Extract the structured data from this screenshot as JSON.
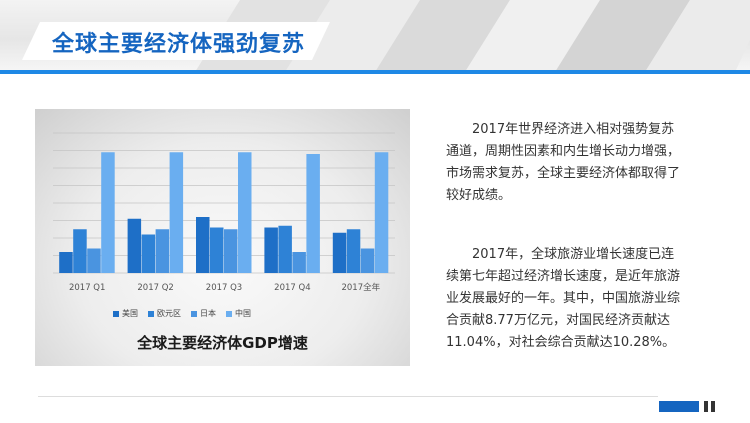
{
  "page": {
    "title": "全球主要经济体强劲复苏"
  },
  "text": {
    "paragraph1_lines": [
      "2017年世界经济进入相对强势复苏",
      "通道，周期性因素和内生增长动力增强，",
      "市场需求复苏，全球主要经济体都取得了",
      "较好成绩。"
    ],
    "paragraph2_lines": [
      "2017年，全球旅游业增长速度已连",
      "续第七年超过经济增长速度，是近年旅游",
      "业发展最好的一年。其中，中国旅游业综",
      "合贡献8.77万亿元，对国民经济贡献达",
      "11.04%，对社会综合贡献达10.28%。"
    ]
  },
  "colors": {
    "accent": "#1e88e5",
    "title": "#1565c0",
    "footer_block": "#1565c0"
  },
  "chart_data": {
    "type": "bar",
    "title": "全球主要经济体GDP增速",
    "categories": [
      "2017 Q1",
      "2017 Q2",
      "2017 Q3",
      "2017 Q4",
      "2017全年"
    ],
    "series": [
      {
        "name": "美国",
        "color": "#1e6fc7",
        "values": [
          1.2,
          3.1,
          3.2,
          2.6,
          2.3
        ]
      },
      {
        "name": "欧元区",
        "color": "#2e82d6",
        "values": [
          2.5,
          2.2,
          2.6,
          2.7,
          2.5
        ]
      },
      {
        "name": "日本",
        "color": "#4a94e0",
        "values": [
          1.4,
          2.5,
          2.5,
          1.2,
          1.4
        ]
      },
      {
        "name": "中国",
        "color": "#6aaef0",
        "values": [
          6.9,
          6.9,
          6.9,
          6.8,
          6.9
        ]
      }
    ],
    "ylim": [
      0,
      8
    ],
    "grid": true,
    "legend_position": "bottom"
  }
}
